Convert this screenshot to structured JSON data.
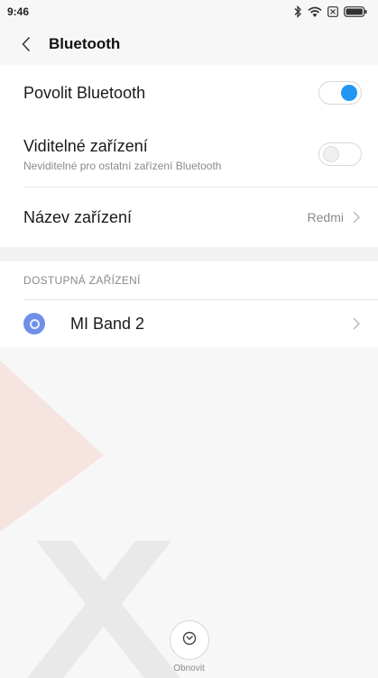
{
  "statusbar": {
    "time": "9:46",
    "icons": [
      "bluetooth-icon",
      "wifi-icon",
      "no-sim-icon",
      "battery-icon"
    ]
  },
  "topbar": {
    "title": "Bluetooth"
  },
  "settings": {
    "enable_label": "Povolit Bluetooth",
    "enable_on": true,
    "visible_label": "Viditelné zařízení",
    "visible_sub": "Neviditelné pro ostatní zařízení Bluetooth",
    "visible_on": false,
    "name_label": "Název zařízení",
    "name_value": "Redmi"
  },
  "available": {
    "header": "DOSTUPNÁ ZAŘÍZENÍ",
    "devices": [
      {
        "name": "MI Band 2",
        "icon": "band-icon"
      }
    ]
  },
  "refresh": {
    "label": "Obnovit"
  },
  "colors": {
    "accent": "#2196f3",
    "device_icon": "#6f8fe8",
    "watermark": "#e85a3c"
  }
}
